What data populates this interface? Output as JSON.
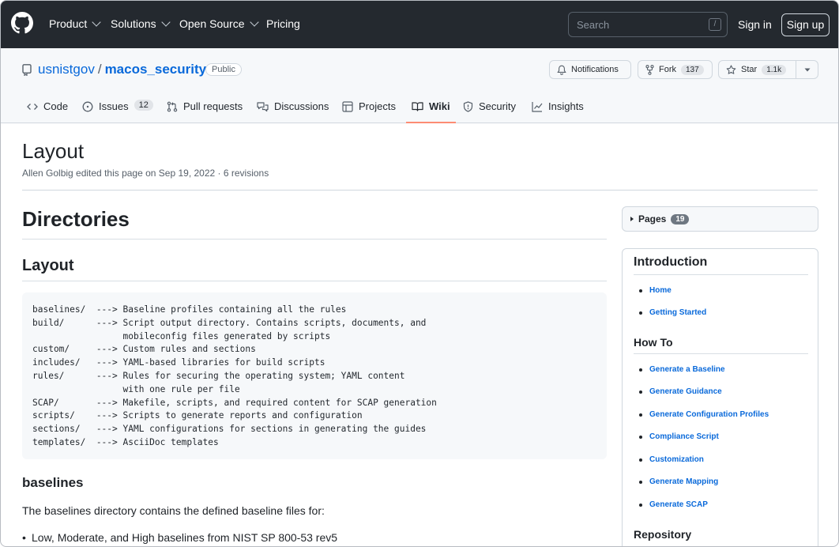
{
  "header": {
    "nav": [
      "Product",
      "Solutions",
      "Open Source",
      "Pricing"
    ],
    "search_placeholder": "Search",
    "search_shortcut": "/",
    "signin": "Sign in",
    "signup": "Sign up"
  },
  "repo": {
    "owner": "usnistgov",
    "separator": "/",
    "name": "macos_security",
    "visibility": "Public",
    "notifications_label": "Notifications",
    "fork_label": "Fork",
    "fork_count": "137",
    "star_label": "Star",
    "star_count": "1.1k"
  },
  "tabs": [
    {
      "label": "Code",
      "icon": "code-icon"
    },
    {
      "label": "Issues",
      "icon": "issue-icon",
      "count": "12"
    },
    {
      "label": "Pull requests",
      "icon": "pull-request-icon"
    },
    {
      "label": "Discussions",
      "icon": "discussion-icon"
    },
    {
      "label": "Projects",
      "icon": "table-icon"
    },
    {
      "label": "Wiki",
      "icon": "book-icon",
      "active": true
    },
    {
      "label": "Security",
      "icon": "shield-icon"
    },
    {
      "label": "Insights",
      "icon": "graph-icon"
    }
  ],
  "page": {
    "title": "Layout",
    "meta": "Allen Golbig edited this page on Sep 19, 2022 · 6 revisions"
  },
  "content": {
    "h1": "Directories",
    "h2": "Layout",
    "code": "baselines/  ---> Baseline profiles containing all the rules\nbuild/      ---> Script output directory. Contains scripts, documents, and\n                 mobileconfig files generated by scripts\ncustom/     ---> Custom rules and sections\nincludes/   ---> YAML-based libraries for build scripts\nrules/      ---> Rules for securing the operating system; YAML content\n                 with one rule per file\nSCAP/       ---> Makefile, scripts, and required content for SCAP generation\nscripts/    ---> Scripts to generate reports and configuration\nsections/   ---> YAML configurations for sections in generating the guides\ntemplates/  ---> AsciiDoc templates",
    "h3": "baselines",
    "paragraph": "The baselines directory contains the defined baseline files for:",
    "bullet1": "Low, Moderate, and High baselines from NIST SP 800-53 rev5"
  },
  "sidebar": {
    "pages_label": "Pages",
    "pages_count": "19",
    "intro_heading": "Introduction",
    "intro_links": [
      "Home",
      "Getting Started"
    ],
    "howto_heading": "How To",
    "howto_links": [
      "Generate a Baseline",
      "Generate Guidance",
      "Generate Configuration Profiles",
      "Compliance Script",
      "Customization",
      "Generate Mapping",
      "Generate SCAP"
    ],
    "repo_heading": "Repository"
  }
}
